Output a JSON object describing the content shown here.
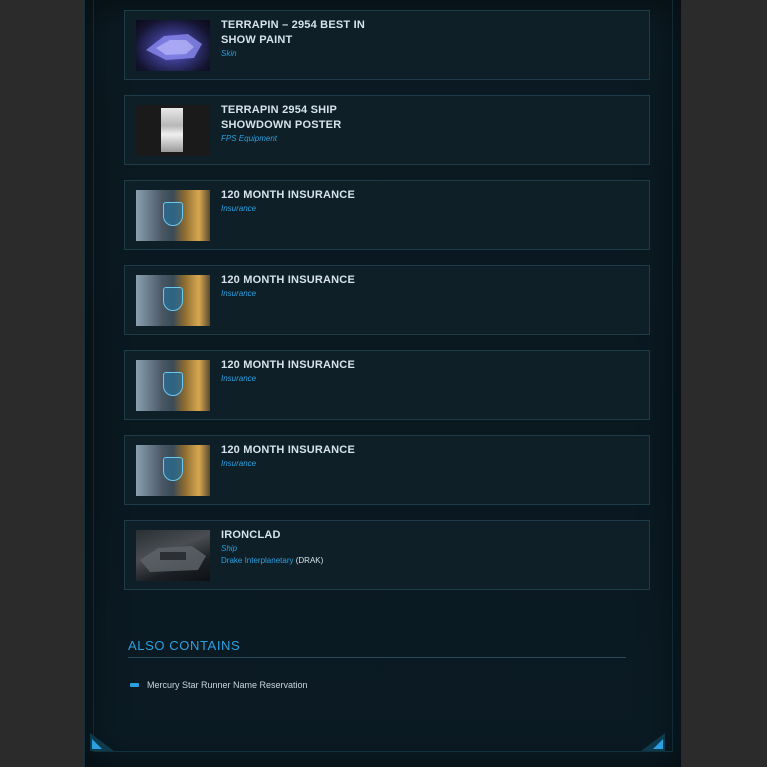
{
  "items": [
    {
      "title": "TERRAPIN – 2954 BEST IN SHOW PAINT",
      "type": "Skin"
    },
    {
      "title": "TERRAPIN 2954 SHIP SHOWDOWN POSTER",
      "type": "FPS Equipment"
    },
    {
      "title": "120 MONTH INSURANCE",
      "type": "Insurance"
    },
    {
      "title": "120 MONTH INSURANCE",
      "type": "Insurance"
    },
    {
      "title": "120 MONTH INSURANCE",
      "type": "Insurance"
    },
    {
      "title": "120 MONTH INSURANCE",
      "type": "Insurance"
    },
    {
      "title": "IRONCLAD",
      "type": "Ship",
      "manufacturer": "Drake Interplanetary",
      "manufacturer_code": "(DRAK)"
    }
  ],
  "also_contains": {
    "heading": "ALSO CONTAINS",
    "items": [
      "Mercury Star Runner Name Reservation"
    ]
  },
  "colors": {
    "accent": "#2aa0e0",
    "panel_bg": "#0b1a22",
    "card_bg": "#0e1f28",
    "page_bg": "#2b2b2b"
  }
}
